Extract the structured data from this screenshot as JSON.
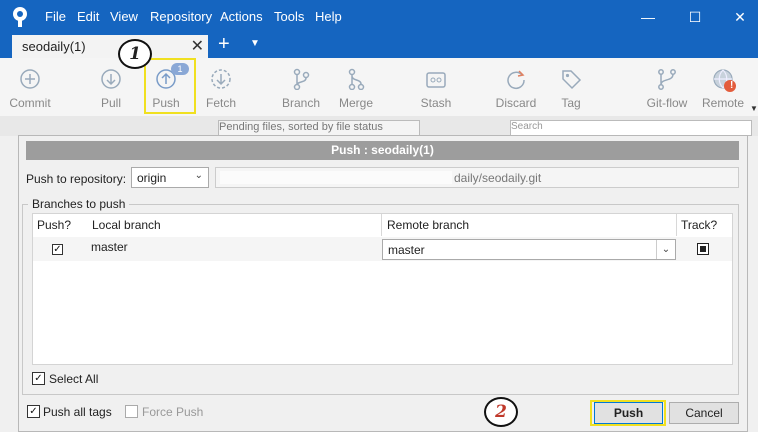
{
  "window": {
    "menu": [
      "File",
      "Edit",
      "View",
      "Repository",
      "Actions",
      "Tools",
      "Help"
    ],
    "controls": {
      "minimize": "—",
      "maximize": "☐",
      "close": "✕"
    }
  },
  "tab": {
    "label": "seodaily(1)",
    "close": "✕",
    "new_tab": "+",
    "menu": "▼"
  },
  "toolbar": {
    "commit": "Commit",
    "pull": "Pull",
    "push": "Push",
    "push_badge": "1",
    "fetch": "Fetch",
    "branch": "Branch",
    "merge": "Merge",
    "stash": "Stash",
    "discard": "Discard",
    "tag": "Tag",
    "gitflow": "Git-flow",
    "remote": "Remote",
    "remote_alert": "!"
  },
  "background": {
    "file_sort": "Pending files, sorted by file status",
    "search_placeholder": "Search"
  },
  "dialog": {
    "title": "Push : seodaily(1)",
    "repo_label": "Push to repository:",
    "remote_value": "origin",
    "remote_url": "daily/seodaily.git",
    "branches_legend": "Branches to push",
    "columns": {
      "push": "Push?",
      "local": "Local branch",
      "remote": "Remote branch",
      "track": "Track?"
    },
    "rows": [
      {
        "checked": true,
        "local": "master",
        "remote": "master",
        "track": true
      }
    ],
    "select_all": "Select All",
    "push_all_tags": "Push all tags",
    "force_push": "Force Push",
    "push_button": "Push",
    "cancel_button": "Cancel"
  },
  "annotations": {
    "step1": "1",
    "step2": "2"
  },
  "colors": {
    "titlebar": "#1565c0",
    "highlight": "#f0e020",
    "annotation2": "#c0392b"
  }
}
